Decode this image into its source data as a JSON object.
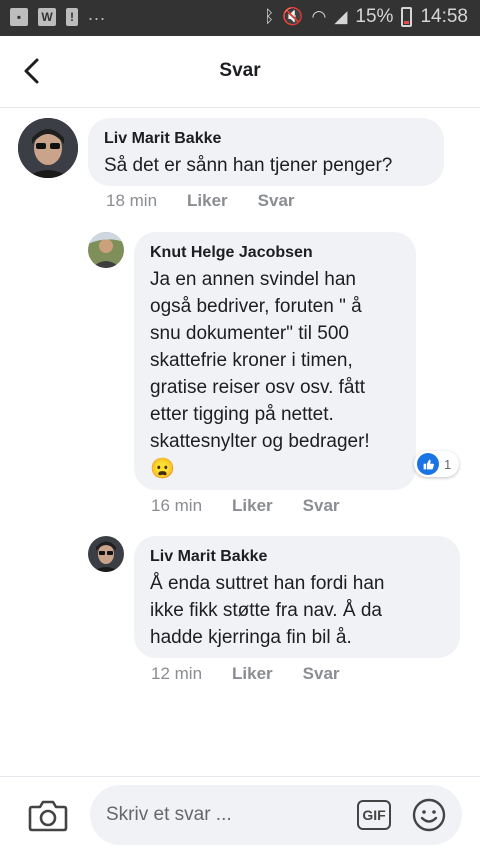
{
  "status_bar": {
    "icons": [
      "image-icon",
      "word-icon",
      "notification-icon"
    ],
    "overflow": "...",
    "battery_percent": "15%",
    "time": "14:58"
  },
  "header": {
    "title": "Svar"
  },
  "comments": [
    {
      "author": "Liv Marit Bakke",
      "text": "Så det er sånn han tjener penger?",
      "time": "18 min",
      "like_label": "Liker",
      "reply_label": "Svar"
    },
    {
      "author": "Knut Helge Jacobsen",
      "text": "Ja en annen svindel han\nogså bedriver, foruten \" å\nsnu dokumenter\" til 500\nskattefrie kroner i timen,\ngratise reiser osv osv. fått\netter tigging på nettet.\nskattesnylter og bedrager!",
      "emoji": "😦",
      "time": "16 min",
      "like_label": "Liker",
      "reply_label": "Svar",
      "reaction_count": "1"
    },
    {
      "author": "Liv Marit Bakke",
      "text": "Å enda suttret han fordi han\nikke fikk støtte fra nav. Å da\nhadde kjerringa fin bil å.",
      "time": "12 min",
      "like_label": "Liker",
      "reply_label": "Svar"
    }
  ],
  "composer": {
    "placeholder": "Skriv et svar ...",
    "gif_label": "GIF"
  },
  "colors": {
    "status_bar": "#333333",
    "bubble": "#f0f2f5",
    "like_blue": "#1b74e4",
    "meta_gray": "#8a8d91"
  }
}
